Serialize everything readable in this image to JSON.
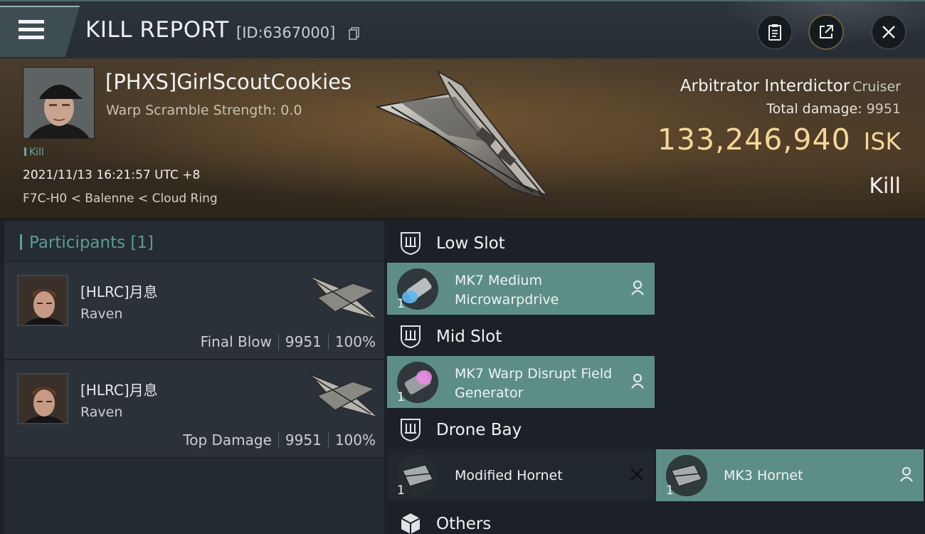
{
  "header": {
    "title": "KILL REPORT",
    "report_id": "[ID:6367000]",
    "icons": [
      "menu-icon",
      "copy-icon",
      "clipboard-icon",
      "share-icon",
      "close-icon"
    ]
  },
  "victim": {
    "name": "[PHXS]GirlScoutCookies",
    "warp_scramble": "Warp Scramble Strength: 0.0",
    "tag": "Kill",
    "time": "2021/11/13 16:21:57 UTC +8",
    "location": "F7C-H0 < Balenne < Cloud Ring",
    "ship_name": "Arbitrator Interdictor",
    "ship_class": "Cruiser",
    "total_damage_label": "Total damage:",
    "total_damage": "9951",
    "isk_value": "133,246,940",
    "isk_unit": "ISK",
    "result": "Kill"
  },
  "participants": {
    "header": "Participants [1]",
    "rows": [
      {
        "name": "[HLRC]月息",
        "ship": "Raven",
        "role": "Final Blow",
        "damage": "9951",
        "percent": "100%"
      },
      {
        "name": "[HLRC]月息",
        "ship": "Raven",
        "role": "Top Damage",
        "damage": "9951",
        "percent": "100%"
      }
    ]
  },
  "fittings": {
    "low_slot": {
      "title": "Low Slot",
      "modules": [
        {
          "name": "MK7 Medium Microwarpdrive",
          "qty": "1"
        }
      ]
    },
    "mid_slot": {
      "title": "Mid Slot",
      "modules": [
        {
          "name": "MK7 Warp Disrupt Field Generator",
          "qty": "1"
        }
      ]
    },
    "drone_bay": {
      "title": "Drone Bay",
      "modules": [
        {
          "name": "Modified Hornet",
          "qty": "1",
          "status": "destroyed"
        },
        {
          "name": "MK3  Hornet",
          "qty": "1",
          "status": "dropped"
        }
      ]
    },
    "others": {
      "title": "Others"
    }
  },
  "colors": {
    "accent_teal": "#5d9b96",
    "module_dropped": "#5d8e86",
    "isk_gold": "#f5d799"
  }
}
